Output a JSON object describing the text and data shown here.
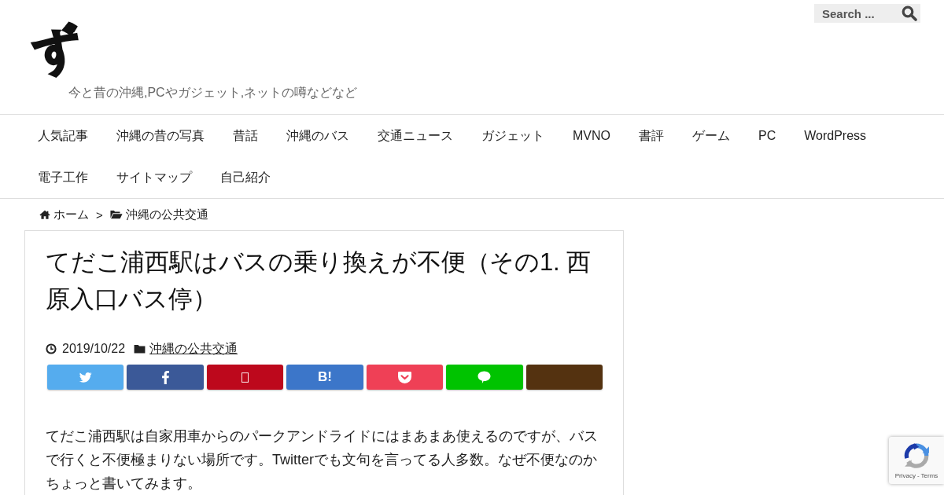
{
  "header": {
    "logo": "ず",
    "tagline": "今と昔の沖縄,PCやガジェット,ネットの噂などなど",
    "search": {
      "placeholder": "Search ..."
    }
  },
  "nav": {
    "items": [
      "人気記事",
      "沖縄の昔の写真",
      "昔話",
      "沖縄のバス",
      "交通ニュース",
      "ガジェット",
      "MVNO",
      "書評",
      "ゲーム",
      "PC",
      "WordPress",
      "電子工作",
      "サイトマップ",
      "自己紹介"
    ]
  },
  "breadcrumb": {
    "separator": ">",
    "items": [
      {
        "kind": "home",
        "label": "ホーム"
      },
      {
        "kind": "folder",
        "label": "沖縄の公共交通"
      }
    ]
  },
  "article": {
    "title": "てだこ浦西駅はバスの乗り換えが不便（その1. 西原入口バス停）",
    "date": "2019/10/22",
    "category": "沖縄の公共交通",
    "share_buttons": [
      {
        "kind": "bird",
        "color": "#55acee"
      },
      {
        "kind": "letter-f",
        "color": "#3b5998"
      },
      {
        "kind": "square",
        "color": "#bd081c"
      },
      {
        "kind": "text",
        "label": "B!",
        "color": "#3c76c9"
      },
      {
        "kind": "pocket",
        "color": "#ef4056"
      },
      {
        "kind": "bubble",
        "color": "#00c300"
      },
      {
        "kind": "plain",
        "color": "#543210"
      }
    ],
    "body": "てだこ浦西駅は自家用車からのパークアンドライドにはまあまあ使えるのですが、バスで行くと不便極まりない場所です。Twitterでも文句を言ってる人多数。なぜ不便なのかちょっと書いてみます。"
  },
  "recaptcha": {
    "links": [
      "Privacy",
      "Terms"
    ],
    "separator": "-"
  }
}
